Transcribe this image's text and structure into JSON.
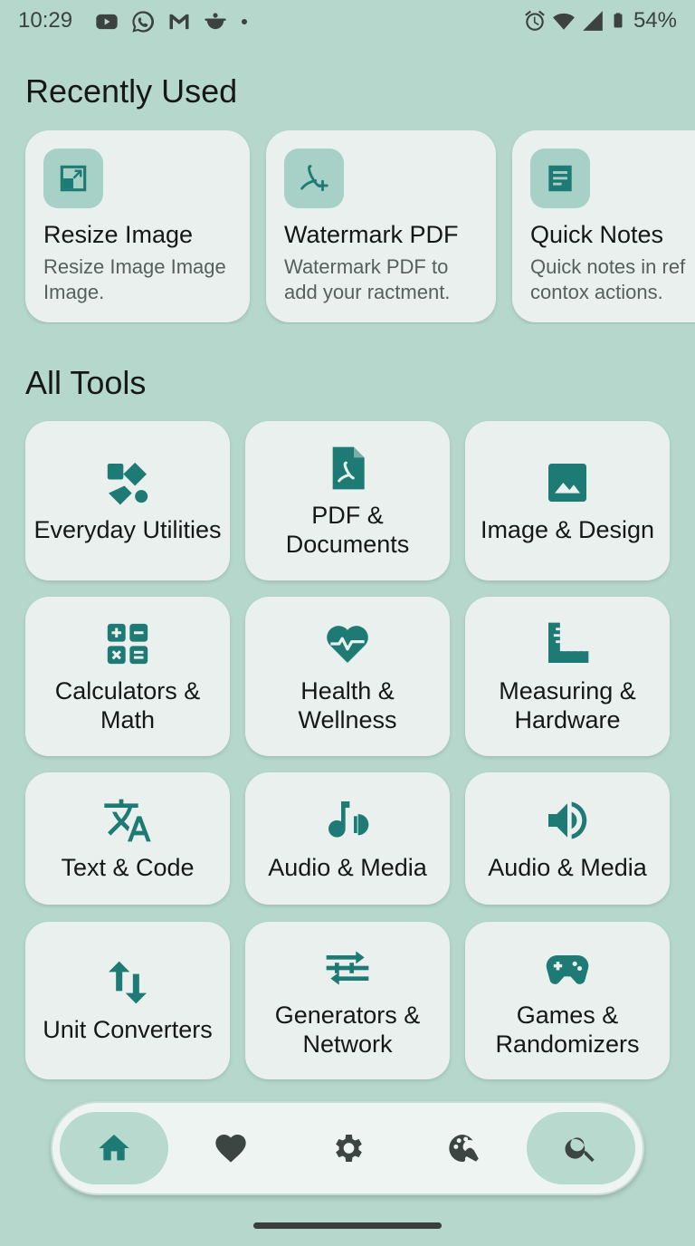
{
  "status_bar": {
    "time": "10:29",
    "left_icons": [
      "youtube-icon",
      "whatsapp-icon",
      "gmail-icon",
      "cloud-bot-icon",
      "dot-icon"
    ],
    "right_icons": [
      "alarm-icon",
      "wifi-icon",
      "signal-icon",
      "battery-icon"
    ],
    "battery": "54%"
  },
  "recently_used": {
    "title": "Recently Used",
    "items": [
      {
        "title": "Resize Image",
        "description": "Resize Image Image Image.",
        "icon": "resize-icon"
      },
      {
        "title": "Watermark PDF",
        "description": "Watermark PDF to add your ractment.",
        "icon": "pdf-add-icon"
      },
      {
        "title": "Quick Notes",
        "description": "Quick notes in ref contox actions.",
        "icon": "notes-icon"
      }
    ]
  },
  "all_tools": {
    "title": "All Tools",
    "items": [
      {
        "label": "Everyday Utilities",
        "icon": "utilities-icon"
      },
      {
        "label": "PDF & Documents",
        "icon": "pdf-document-icon"
      },
      {
        "label": "Image & Design",
        "icon": "image-icon"
      },
      {
        "label": "Calculators & Math",
        "icon": "calculator-icon"
      },
      {
        "label": "Health & Wellness",
        "icon": "heart-pulse-icon"
      },
      {
        "label": "Measuring & Hardware",
        "icon": "ruler-icon"
      },
      {
        "label": "Text & Code",
        "icon": "translate-icon"
      },
      {
        "label": "Audio & Media",
        "icon": "music-note-icon"
      },
      {
        "label": "Audio & Media",
        "icon": "speaker-icon"
      },
      {
        "label": "Unit Converters",
        "icon": "swap-vertical-icon"
      },
      {
        "label": "Generators & Network",
        "icon": "generator-icon"
      },
      {
        "label": "Games & Randomizers",
        "icon": "gamepad-icon"
      }
    ]
  },
  "bottom_nav": {
    "items": [
      {
        "name": "home",
        "icon": "home-icon",
        "active": true
      },
      {
        "name": "favorites",
        "icon": "heart-icon",
        "active": false
      },
      {
        "name": "settings",
        "icon": "gear-icon",
        "active": false
      },
      {
        "name": "theme",
        "icon": "palette-tool-icon",
        "active": false
      },
      {
        "name": "search",
        "icon": "search-icon",
        "active": true
      }
    ]
  },
  "colors": {
    "background": "#b6d8cc",
    "card": "#e9f0ee",
    "accent": "#1d7a74",
    "icon_box": "#a7d1c6",
    "nav_active": "#b8d9cd"
  }
}
